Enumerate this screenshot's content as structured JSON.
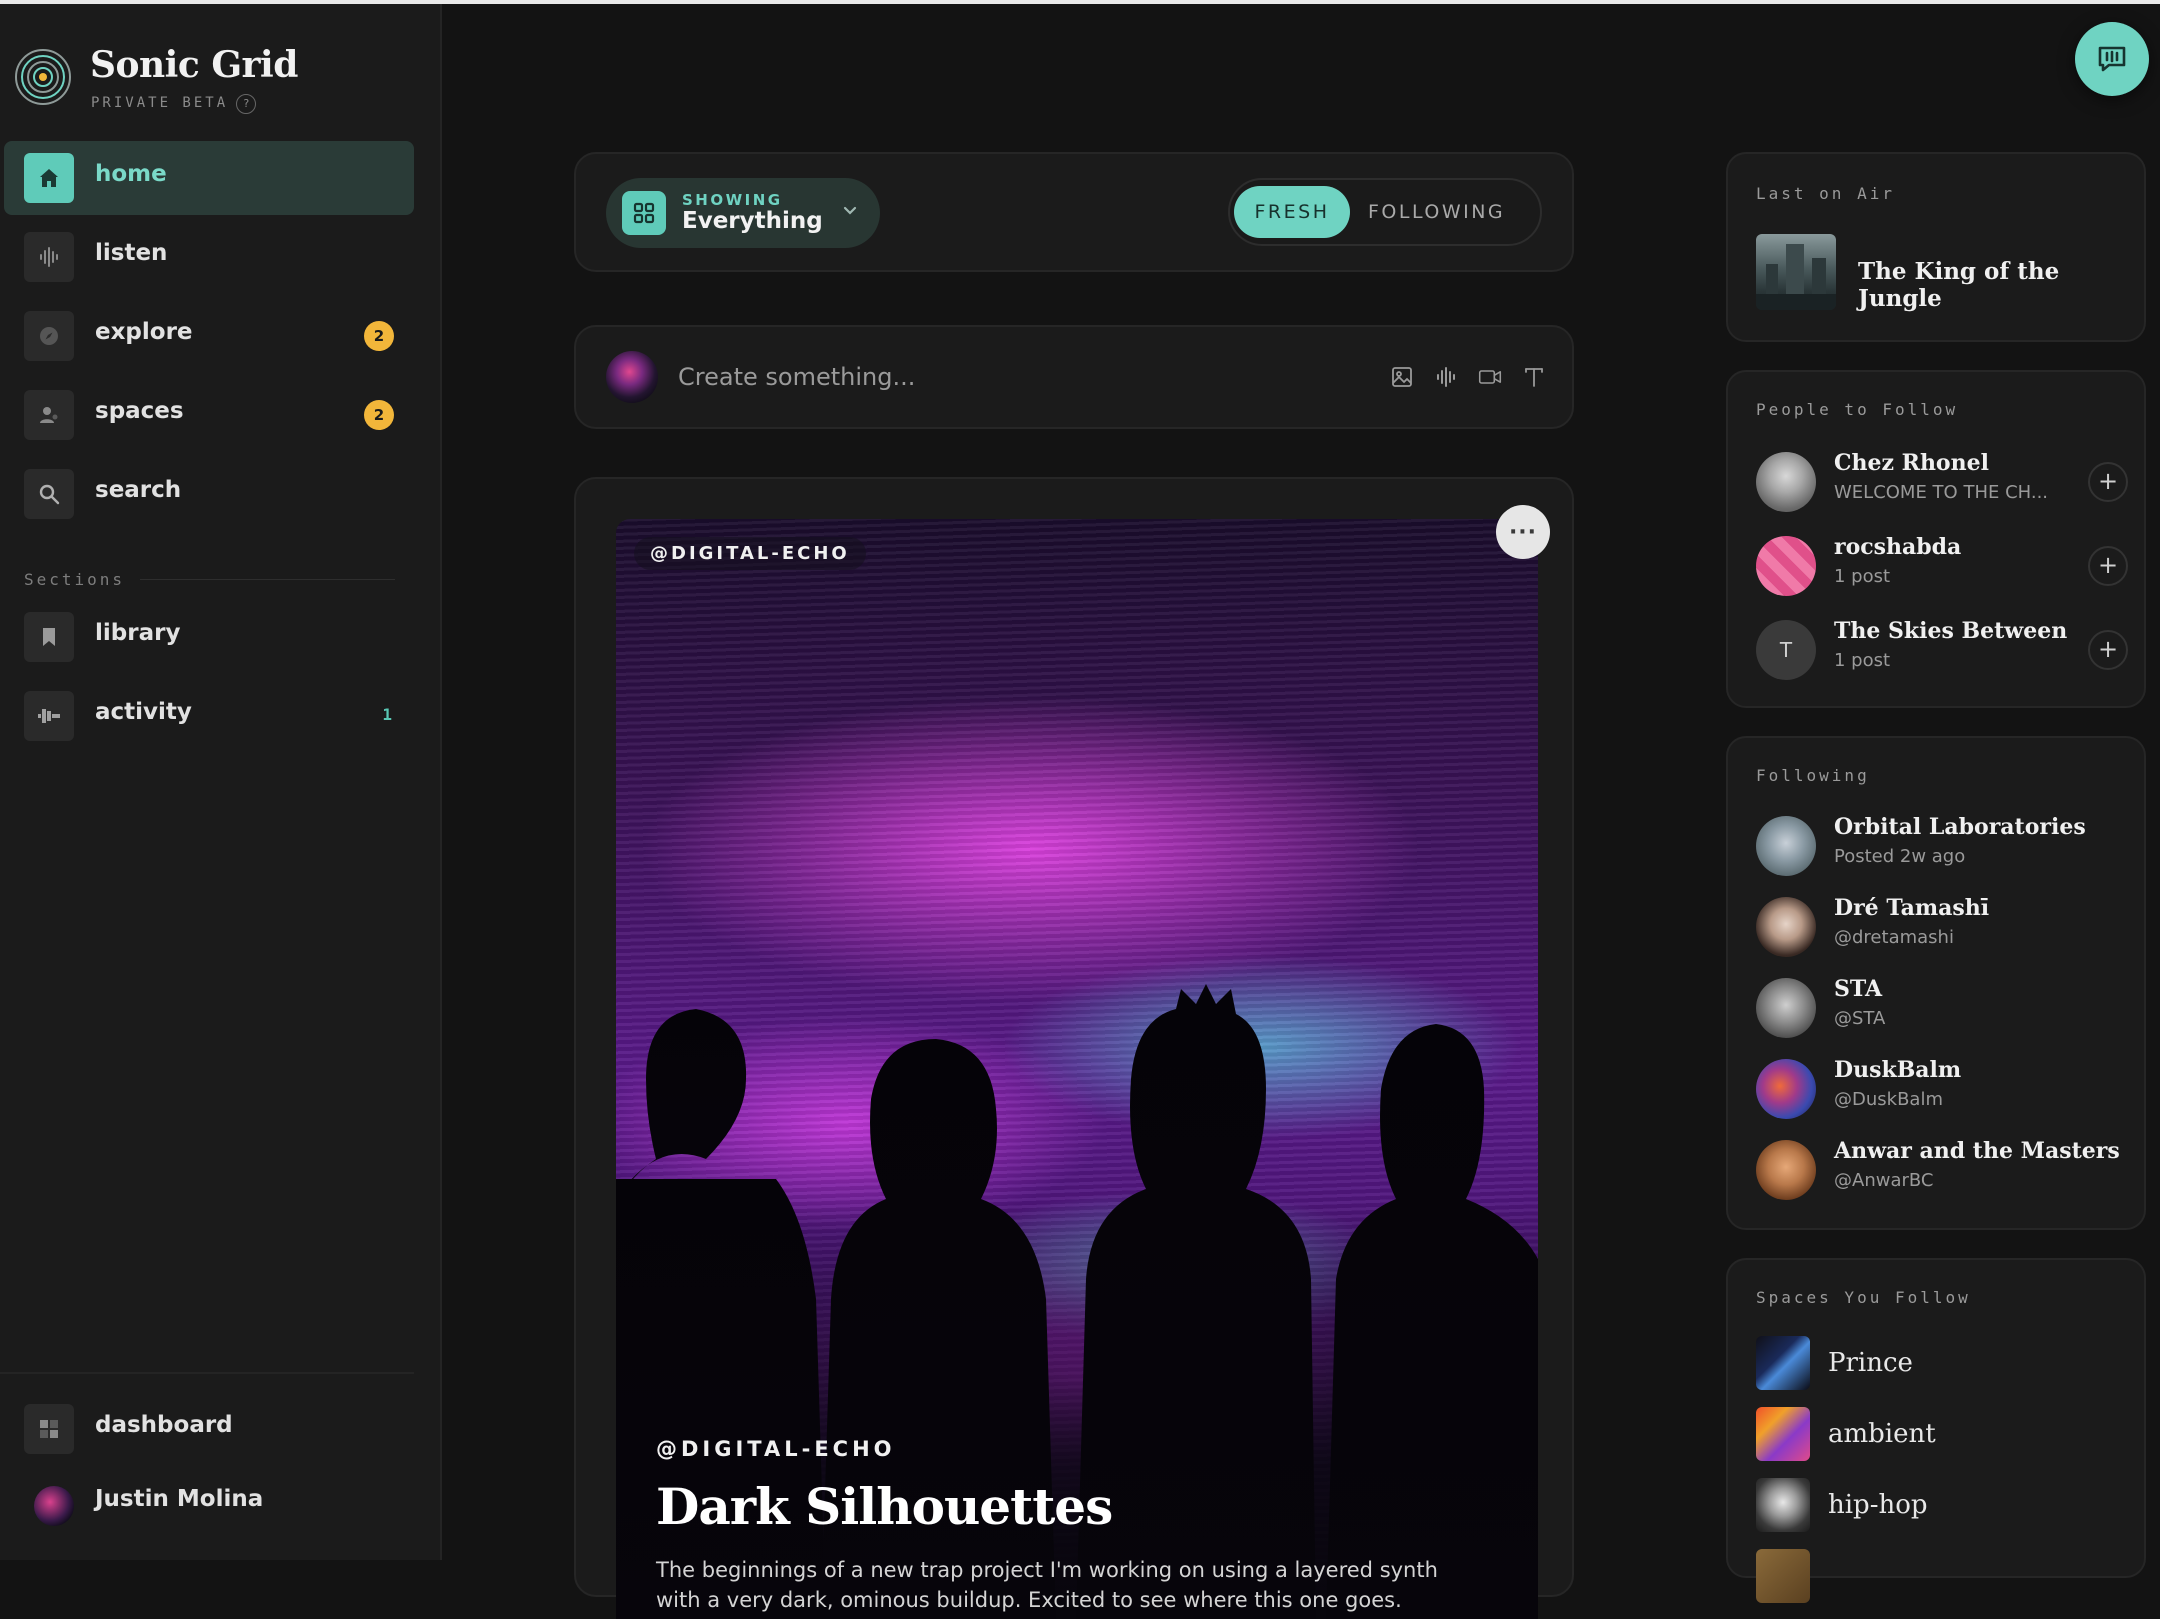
{
  "app": {
    "name": "Sonic Grid",
    "subtitle": "PRIVATE BETA",
    "help": "?"
  },
  "sidebar": {
    "items": [
      {
        "label": "home",
        "icon": "home-icon",
        "active": true
      },
      {
        "label": "listen",
        "icon": "waveform-icon"
      },
      {
        "label": "explore",
        "icon": "compass-icon",
        "badge": "2"
      },
      {
        "label": "spaces",
        "icon": "person-icon",
        "badge": "2"
      },
      {
        "label": "search",
        "icon": "search-icon"
      }
    ],
    "section_label": "Sections",
    "section_items": [
      {
        "label": "library",
        "icon": "bookmark-icon"
      },
      {
        "label": "activity",
        "icon": "activity-icon",
        "count": "1"
      }
    ],
    "bottom": {
      "dashboard": "dashboard",
      "user_name": "Justin Molina"
    }
  },
  "filter": {
    "showing_caption": "SHOWING",
    "showing_value": "Everything",
    "tabs": [
      "FRESH",
      "FOLLOWING"
    ],
    "active_tab": "FRESH"
  },
  "composer": {
    "placeholder": "Create something...",
    "tools": [
      "image-icon",
      "audio-icon",
      "video-icon",
      "text-icon"
    ]
  },
  "post": {
    "handle_badge": "@DIGITAL-ECHO",
    "handle": "@DIGITAL-ECHO",
    "title": "Dark Silhouettes",
    "description": "The beginnings of a new trap project I'm working on using a layered synth with a very dark, ominous buildup. Excited to see where this one goes.",
    "menu": "···"
  },
  "right": {
    "last_on_air": {
      "caption": "Last on Air",
      "title": "The King of the Jungle"
    },
    "people_to_follow": {
      "caption": "People to Follow",
      "people": [
        {
          "name": "Chez Rhonel",
          "sub": "WELCOME TO THE CH..."
        },
        {
          "name": "rocshabda",
          "sub": "1 post"
        },
        {
          "name": "The Skies Between",
          "sub": "1 post",
          "initial": "T"
        }
      ]
    },
    "following": {
      "caption": "Following",
      "people": [
        {
          "name": "Orbital Laboratories",
          "sub": "Posted 2w ago"
        },
        {
          "name": "Dré Tamashī",
          "sub": "@dretamashi"
        },
        {
          "name": "STA",
          "sub": "@STA"
        },
        {
          "name": "DuskBalm",
          "sub": "@DuskBalm"
        },
        {
          "name": "Anwar and the Masters",
          "sub": "@AnwarBC"
        }
      ]
    },
    "spaces": {
      "caption": "Spaces You Follow",
      "items": [
        "Prince",
        "ambient",
        "hip-hop"
      ]
    }
  },
  "colors": {
    "accent": "#6fd3c2",
    "badge": "#f2b63a",
    "background": "#131313",
    "panel": "#1b1b1b"
  }
}
